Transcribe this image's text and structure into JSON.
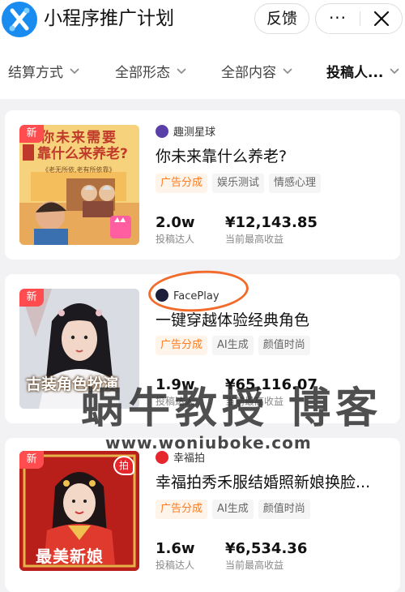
{
  "header": {
    "title": "小程序推广计划",
    "feedback_label": "反馈",
    "more_label": "···"
  },
  "filters": [
    {
      "label": "结算方式"
    },
    {
      "label": "全部形态"
    },
    {
      "label": "全部内容"
    },
    {
      "label": "投稿人..."
    }
  ],
  "new_label": "新",
  "cards": [
    {
      "source": "趣测星球",
      "title": "你未来靠什么养老?",
      "tags": [
        "广告分成",
        "娱乐测试",
        "情感心理"
      ],
      "submitters": "2.0w",
      "submitters_label": "投稿达人",
      "earnings": "¥12,143.85",
      "earnings_label": "当前最高收益",
      "thumb_text": [
        "你未来需要",
        "靠什么来养老?"
      ],
      "thumb_caption": "《老无所依,老有所依靠》"
    },
    {
      "source": "FacePlay",
      "title": "一键穿越体验经典角色",
      "tags": [
        "广告分成",
        "AI生成",
        "颜值时尚"
      ],
      "submitters": "1.9w",
      "submitters_label": "投稿达人",
      "earnings": "¥65,116.07",
      "earnings_label": "当前最高收益",
      "thumb_text": [
        "古装角色扮演"
      ]
    },
    {
      "source": "幸福拍",
      "title": "幸福拍秀禾服结婚照新娘换脸...",
      "tags": [
        "广告分成",
        "AI生成",
        "颜值时尚"
      ],
      "submitters": "1.6w",
      "submitters_label": "投稿达人",
      "earnings": "¥6,534.36",
      "earnings_label": "当前最高收益",
      "thumb_text": [
        "最美新娘"
      ],
      "thumb_badge": "拍"
    }
  ],
  "watermark": {
    "main": "蜗牛教授 博客",
    "url": "www.woniuboke.com"
  },
  "colors": {
    "accent": "#ff7a1f",
    "new_badge": "#ff4d4f",
    "annotation_circle": "#f26b2a",
    "logo_blue": "#1a8cf0"
  }
}
